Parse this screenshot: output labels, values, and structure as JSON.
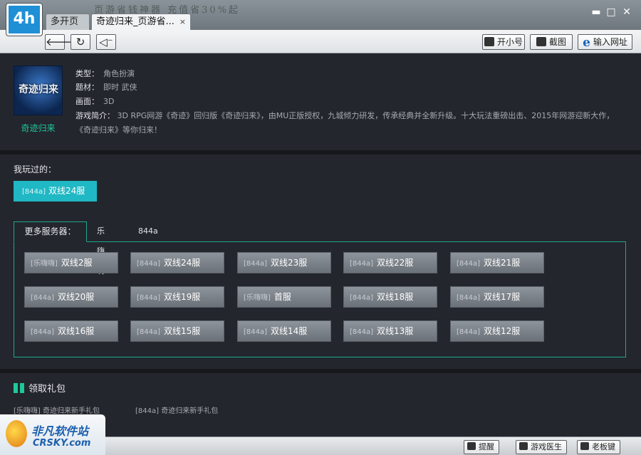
{
  "titlebar": {
    "logo_text": "4h",
    "slogan": "页游省钱神器  充值省30%起",
    "tabs": [
      {
        "label": "多开页面"
      },
      {
        "label": "奇迹归来_页游省..."
      }
    ],
    "tab_close_glyph": "×",
    "window_controls": {
      "minimize": "▬",
      "maximize": "□",
      "close": "✕"
    }
  },
  "toolbar": {
    "back_glyph": "🡐",
    "refresh_glyph": "↻",
    "mute_glyph": "◁⁻",
    "buttons": [
      {
        "label": "开小号",
        "icon": "account-icon"
      },
      {
        "label": "截图",
        "icon": "screenshot-icon"
      },
      {
        "label": "输入网址",
        "icon": "ie-icon"
      }
    ],
    "ie_glyph": "e"
  },
  "game": {
    "cover_text": "奇迹归来",
    "name": "奇迹归来",
    "type_label": "类型：",
    "type_value": "角色扮演",
    "theme_label": "题材：",
    "theme_value": "即时 武侠",
    "graphics_label": "画面：",
    "graphics_value": "3D",
    "intro_label": "游戏简介：",
    "intro_value": "3D RPG网游《奇迹》回归版《奇迹归来》，由MU正版授权，九城倾力研发，传承经典并全新升级。十大玩法重磅出击、2015年网游迎新大作，《奇迹归来》等你归来！"
  },
  "played": {
    "title": "我玩过的：",
    "server": {
      "tag": "[844a]",
      "name": "双线24服"
    }
  },
  "servers": {
    "tab_main": "更多服务器：",
    "tabs": [
      "乐嗨嗨",
      "844a"
    ],
    "items": [
      {
        "tag": "[乐嗨嗨]",
        "name": "双线2服"
      },
      {
        "tag": "[844a]",
        "name": "双线24服"
      },
      {
        "tag": "[844a]",
        "name": "双线23服"
      },
      {
        "tag": "[844a]",
        "name": "双线22服"
      },
      {
        "tag": "[844a]",
        "name": "双线21服"
      },
      {
        "tag": "[844a]",
        "name": "双线20服"
      },
      {
        "tag": "[844a]",
        "name": "双线19服"
      },
      {
        "tag": "[乐嗨嗨]",
        "name": "首服"
      },
      {
        "tag": "[844a]",
        "name": "双线18服"
      },
      {
        "tag": "[844a]",
        "name": "双线17服"
      },
      {
        "tag": "[844a]",
        "name": "双线16服"
      },
      {
        "tag": "[844a]",
        "name": "双线15服"
      },
      {
        "tag": "[844a]",
        "name": "双线14服"
      },
      {
        "tag": "[844a]",
        "name": "双线13服"
      },
      {
        "tag": "[844a]",
        "name": "双线12服"
      }
    ]
  },
  "gifts": {
    "title": "领取礼包",
    "links": [
      "[乐嗨嗨] 奇迹归来新手礼包",
      "[844a] 奇迹归来新手礼包"
    ]
  },
  "bottombar": {
    "buttons": [
      {
        "label": "提醒"
      },
      {
        "label": "游戏医生"
      },
      {
        "label": "老板键"
      }
    ]
  },
  "watermark": {
    "cn": "非凡软件站",
    "en": "CRSKY.com"
  }
}
